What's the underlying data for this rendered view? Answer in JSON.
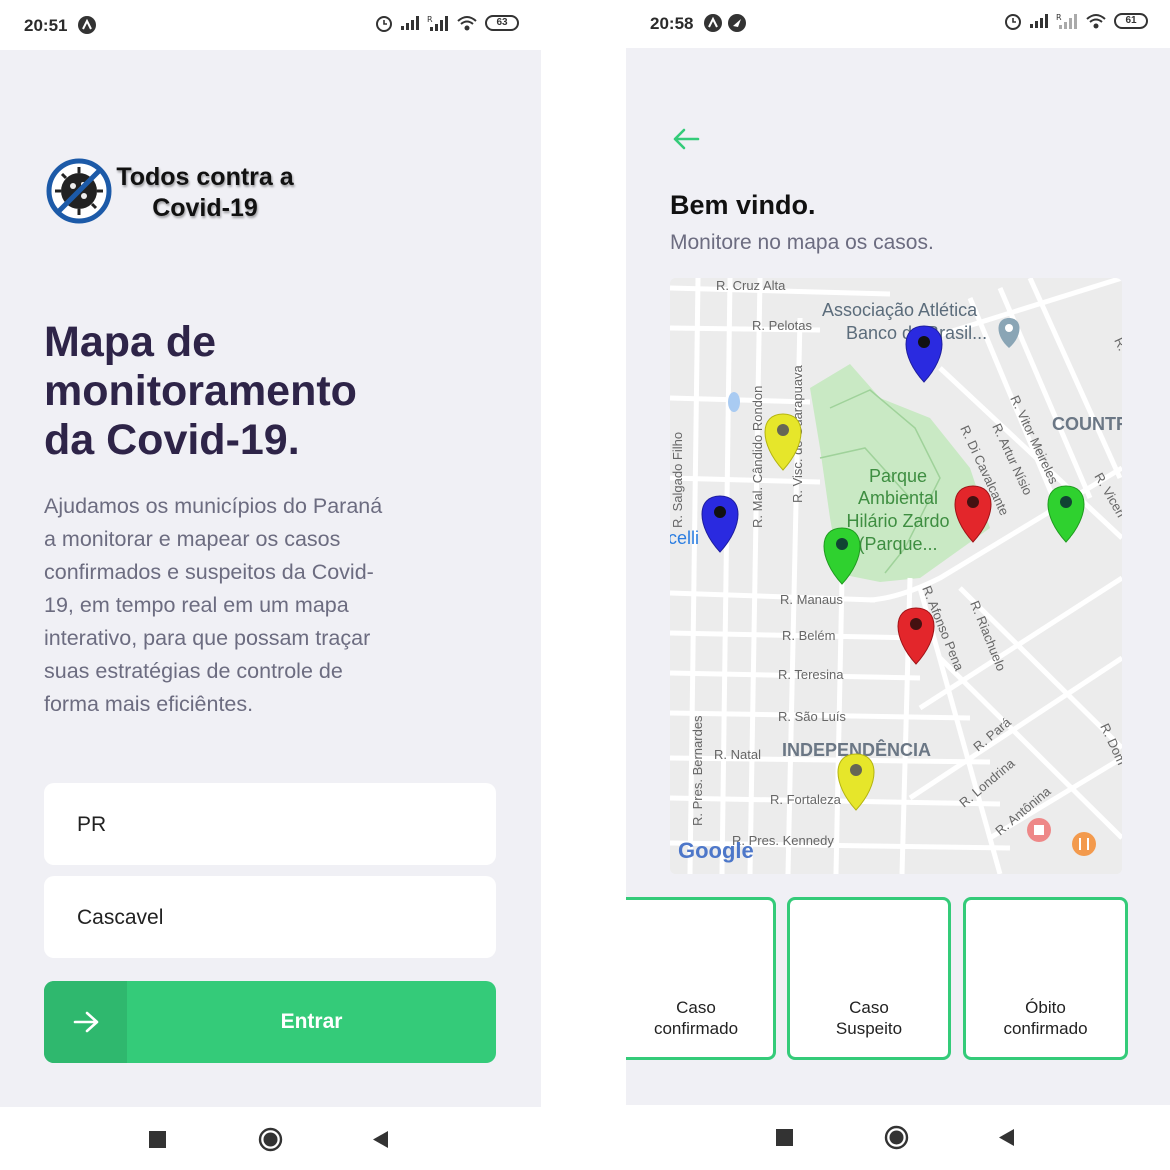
{
  "left_screen": {
    "status_time": "20:51",
    "battery": "63",
    "logo_text_line1": "Todos contra a",
    "logo_text_line2": "Covid-19",
    "title": "Mapa de monitoramento da Covid-19.",
    "description": "Ajudamos os municípios do Paraná a monitorar e mapear os casos confirmados e suspeitos da Covid-19, em tempo real em um mapa interativo, para que possam traçar suas estratégias de controle de forma mais eficiêntes.",
    "uf_value": "PR",
    "city_value": "Cascavel",
    "enter_label": "Entrar"
  },
  "right_screen": {
    "status_time": "20:58",
    "battery": "61",
    "welcome_title": "Bem vindo.",
    "welcome_subtitle": "Monitore no mapa os casos.",
    "map": {
      "streets": [
        "R. Cruz Alta",
        "R. Pelotas",
        "R. Visc. de Guarapuava",
        "R. Mal. Cândido Rondon",
        "R. Salgado Filho",
        "R. Manaus",
        "R. Belém",
        "R. Teresina",
        "R. São Luís",
        "R. Natal",
        "R. Fortaleza",
        "R. Pres. Bernardes",
        "R. Pres. Kennedy",
        "R. Afonso Pena",
        "R. Riachuelo",
        "R. Pará",
        "R. Londrina",
        "R. Antônina",
        "R. Di Cavalcante",
        "R. Artur Nísio",
        "R. Vitor Meireles",
        "R. Vicen",
        "R. Dom",
        "R.",
        "celli"
      ],
      "places": [
        "Associação Atlética Banco do Brasil...",
        "Parque Ambiental Hilário Zardo (Parque...",
        "INDEPENDÊNCIA",
        "COUNTR"
      ],
      "google_logo": "Google",
      "marker_colors": {
        "confirmed": "#e3262b",
        "suspect": "#e6e62a",
        "death": "#2a2ae0",
        "recovered": "#2fd12f"
      }
    },
    "cards": [
      {
        "label": "Caso\nconfirmado"
      },
      {
        "label": "Caso\nSuspeito"
      },
      {
        "label": "Óbito\nconfirmado"
      }
    ]
  },
  "colors": {
    "accent": "#34cb79",
    "title": "#2e2448",
    "text": "#6c6c80",
    "background": "#f0f0f5"
  }
}
